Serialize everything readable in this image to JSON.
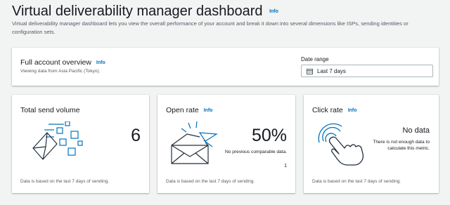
{
  "header": {
    "title": "Virtual deliverability manager dashboard",
    "info": "Info",
    "description": "Virtual deliverability manager dashboard lets you view the overall performance of your account and break it down into several dimensions like ISPs, sending identities or configuration sets."
  },
  "overview": {
    "title": "Full account overview",
    "info": "Info",
    "subtitle": "Viewing data from Asia Pacific (Tokyo).",
    "date_range_label": "Date range",
    "date_range_value": "Last 7 days"
  },
  "metrics": [
    {
      "title": "Total send volume",
      "value": "6",
      "footer": "Data is based on the last 7 days of sending."
    },
    {
      "title": "Open rate",
      "info": "Info",
      "value": "50%",
      "note": "No previous comparable data.",
      "count": "1",
      "footer": "Data is based on the last 7 days of sending."
    },
    {
      "title": "Click rate",
      "info": "Info",
      "value": "No data",
      "note": "There is not enough data to calculate this metric.",
      "footer": "Data is based on the last 7 days of sending."
    }
  ],
  "colors": {
    "accent": "#0073bb",
    "illustration_blue": "#0073bb",
    "illustration_line": "#232f3e",
    "background": "#f2f3f3"
  },
  "icons": [
    "calendar-icon",
    "envelope-send-illustration",
    "envelope-open-illustration",
    "click-hand-illustration"
  ]
}
